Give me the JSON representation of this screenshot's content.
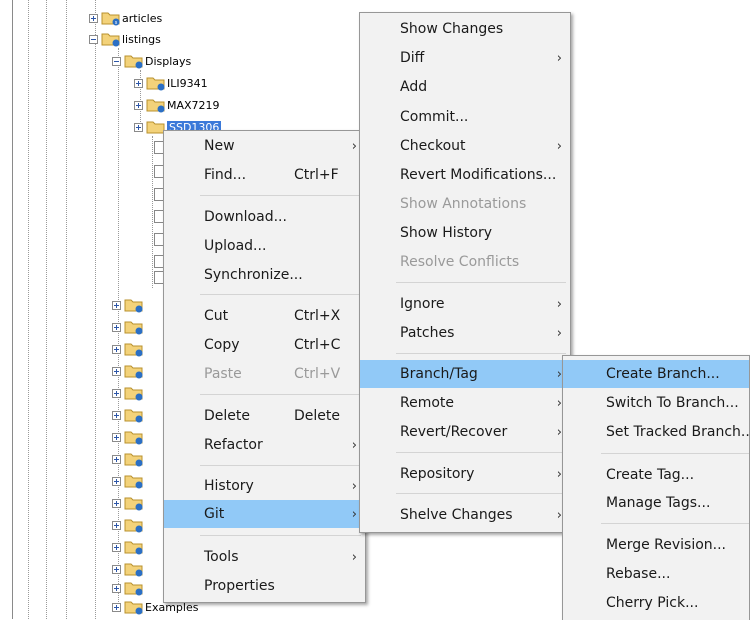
{
  "tree": {
    "articles": "articles",
    "listings": "listings",
    "displays": "Displays",
    "ili9341": "ILI9341",
    "max7219": "MAX7219",
    "ssd1306": "SSD1306",
    "examples": "Examples"
  },
  "menu1": {
    "new": "New",
    "find": "Find...",
    "find_sc": "Ctrl+F",
    "download": "Download...",
    "upload": "Upload...",
    "synchronize": "Synchronize...",
    "cut": "Cut",
    "cut_sc": "Ctrl+X",
    "copy": "Copy",
    "copy_sc": "Ctrl+C",
    "paste": "Paste",
    "paste_sc": "Ctrl+V",
    "delete": "Delete",
    "delete_sc": "Delete",
    "refactor": "Refactor",
    "history": "History",
    "git": "Git",
    "tools": "Tools",
    "properties": "Properties"
  },
  "menu2": {
    "show_changes": "Show Changes",
    "diff": "Diff",
    "add": "Add",
    "commit": "Commit...",
    "checkout": "Checkout",
    "revert_mods": "Revert Modifications...",
    "show_annotations": "Show Annotations",
    "show_history": "Show History",
    "resolve_conflicts": "Resolve Conflicts",
    "ignore": "Ignore",
    "patches": "Patches",
    "branch_tag": "Branch/Tag",
    "remote": "Remote",
    "revert_recover": "Revert/Recover",
    "repository": "Repository",
    "shelve_changes": "Shelve Changes"
  },
  "menu3": {
    "create_branch": "Create Branch...",
    "switch_branch": "Switch To Branch...",
    "set_tracked": "Set Tracked Branch...",
    "create_tag": "Create Tag...",
    "manage_tags": "Manage Tags...",
    "merge_revision": "Merge Revision...",
    "rebase": "Rebase...",
    "cherry_pick": "Cherry Pick..."
  },
  "arrow": "›",
  "colors": {
    "highlight": "#91c9f7",
    "menu_bg": "#f2f2f2",
    "selected_bg": "#3b79d9",
    "folder": "#f3d27a",
    "badge": "#2b6fc4"
  }
}
